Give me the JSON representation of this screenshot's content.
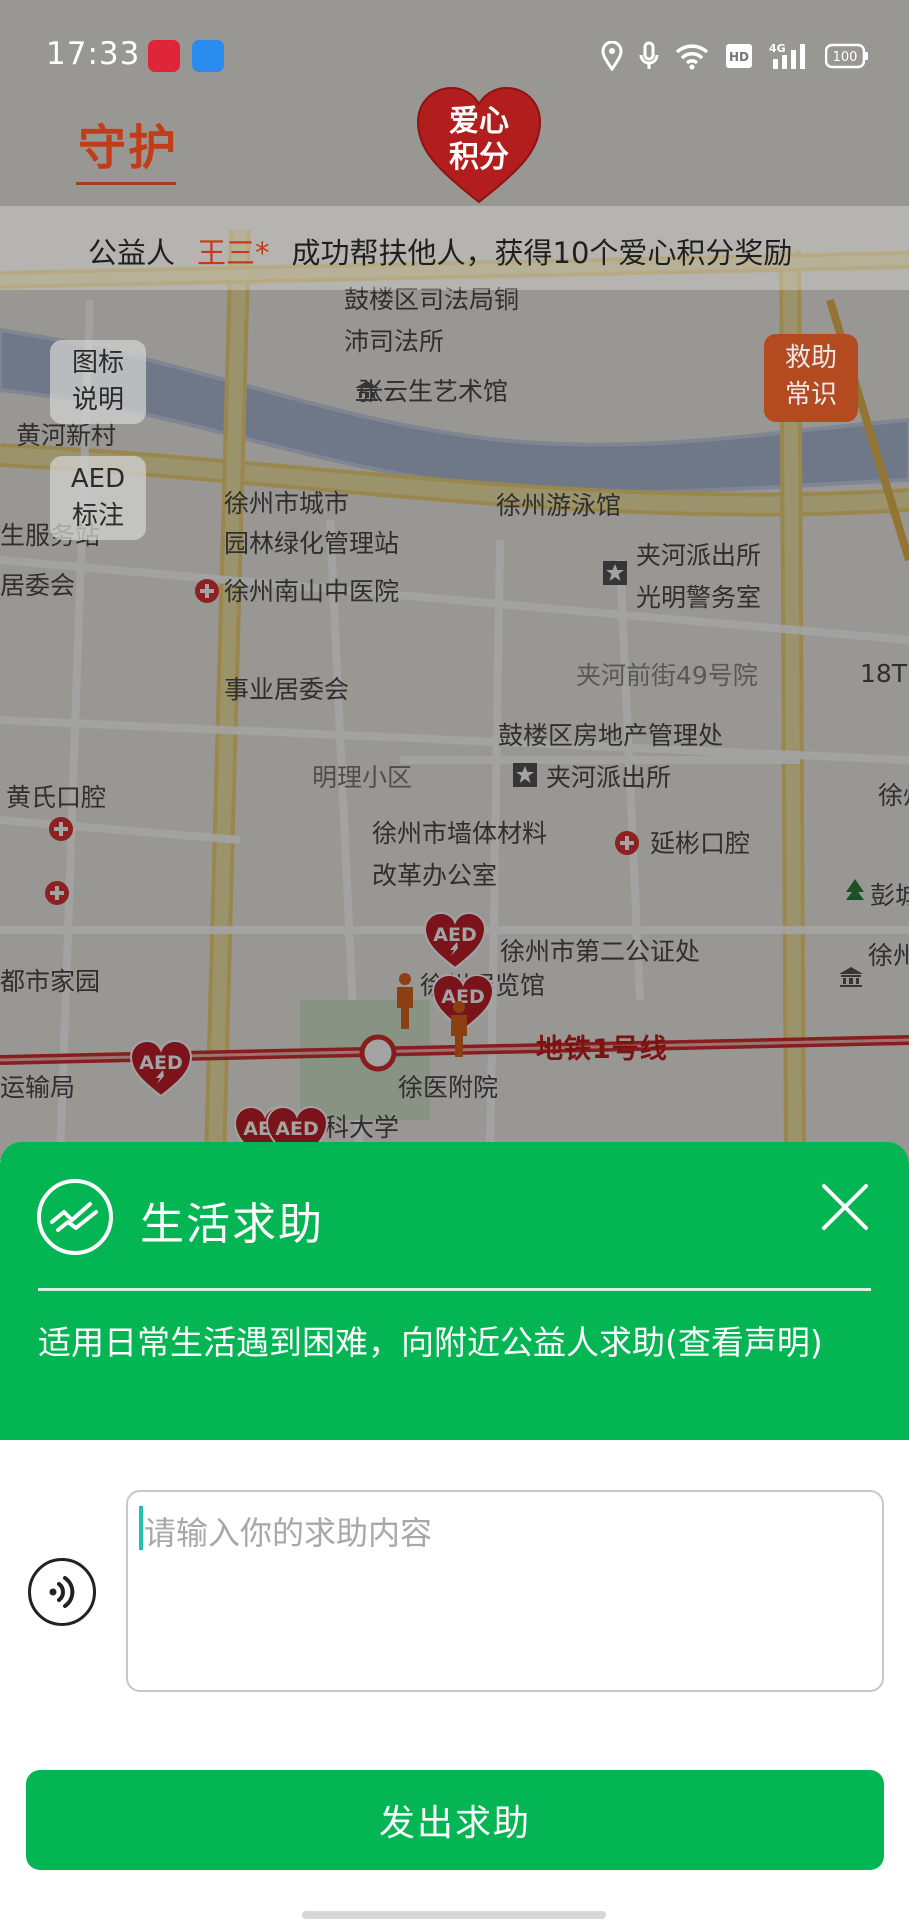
{
  "status_bar": {
    "time": "17:33",
    "app_icons": [
      "xiaohongshu-icon",
      "files-icon"
    ],
    "indicators": [
      "location-icon",
      "mic-icon",
      "wifi-icon",
      "hd-icon",
      "4g-signal-icon",
      "battery-icon"
    ],
    "network": "4G",
    "hd": "HD",
    "battery": "100"
  },
  "header": {
    "tab_label": "守护",
    "logo_line1": "爱心",
    "logo_line2": "积分",
    "ticker_prefix": "公益人",
    "ticker_name": "王三*",
    "ticker_text": "成功帮扶他人，获得10个爱心积分奖励"
  },
  "map": {
    "legend_button": [
      "图标",
      "说明"
    ],
    "aed_button": [
      "AED",
      "标注"
    ],
    "rescue_button": [
      "救助",
      "常识"
    ],
    "labels": [
      "鼓楼区司法局铜",
      "沛司法所",
      "张云生艺术馆",
      "黄河新村",
      "徐州市城市",
      "园林绿化管理站",
      "徐州游泳馆",
      "夹河派出所",
      "光明警务室",
      "徐州南山中医院",
      "夹河前街49号院",
      "事业居委会",
      "鼓楼区房地产管理处",
      "明理小区",
      "夹河派出所",
      "黄氏口腔",
      "徐州市墙体材料",
      "改革办公室",
      "延彬口腔",
      "徐州市第二公证处",
      "都市家园",
      "徐州展览馆",
      "地铁1号线",
      "徐医附院",
      "运输局",
      "科大学",
      "生服务站",
      "居委会",
      "18T",
      "徐州",
      "彭城",
      "徐州城市"
    ],
    "marker_text": "AED",
    "accent": "#c21e1e"
  },
  "sheet": {
    "title": "生活求助",
    "description": "适用日常生活遇到困难，向附近公益人求助(查看声明)",
    "input_placeholder": "请输入你的求助内容",
    "input_value": "",
    "submit_label": "发出求助",
    "color": "#04b553"
  }
}
